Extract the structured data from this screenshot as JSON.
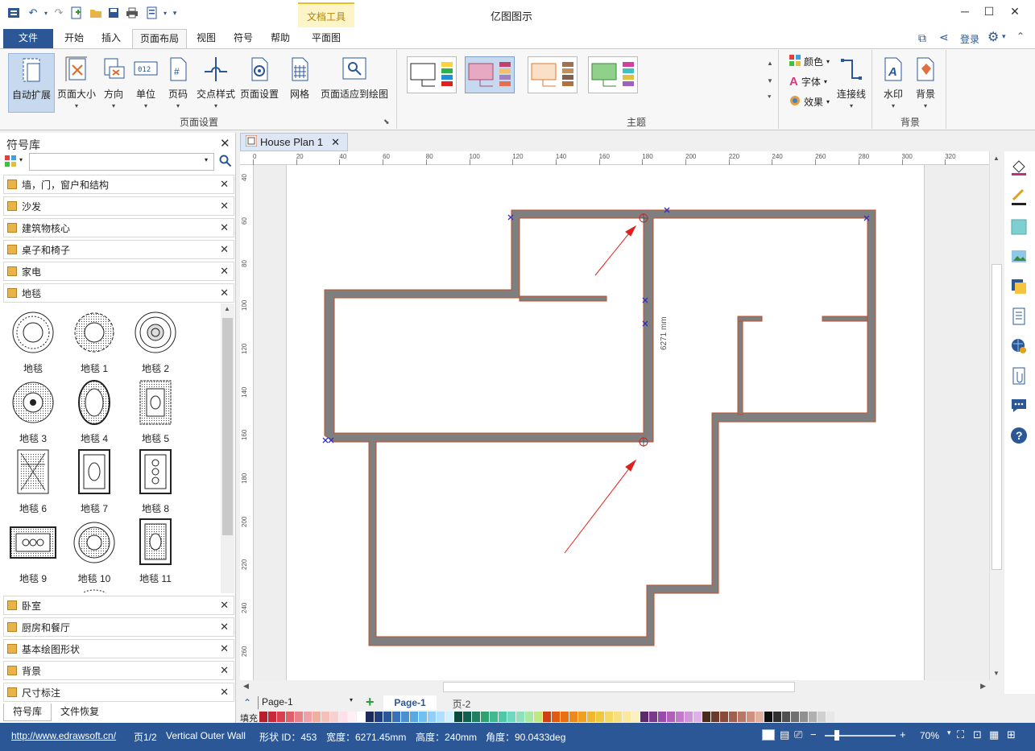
{
  "app": {
    "title": "亿图图示"
  },
  "ribbon": {
    "context_tab_title": "文档工具",
    "tabs": [
      "文件",
      "开始",
      "插入",
      "页面布局",
      "视图",
      "符号",
      "帮助",
      "平面图"
    ],
    "active_tab": "页面布局",
    "page_setup": {
      "buttons": [
        "自动扩展",
        "页面大小",
        "方向",
        "单位",
        "页码",
        "交点样式",
        "页面设置",
        "网格",
        "页面适应到绘图"
      ],
      "group_label": "页面设置"
    },
    "theme": {
      "group_label": "主题",
      "options": [
        "颜色",
        "字体",
        "效果"
      ],
      "connector_label": "连接线"
    },
    "background": {
      "buttons": [
        "水印",
        "背景"
      ],
      "group_label": "背景"
    },
    "login": "登录"
  },
  "library": {
    "title": "符号库",
    "search_placeholder": "",
    "categories_top": [
      "墙，门，窗户和结构",
      "沙发",
      "建筑物核心",
      "桌子和椅子",
      "家电",
      "地毯"
    ],
    "symbols": [
      "地毯",
      "地毯 1",
      "地毯 2",
      "地毯 3",
      "地毯 4",
      "地毯 5",
      "地毯 6",
      "地毯 7",
      "地毯 8",
      "地毯 9",
      "地毯 10",
      "地毯 11"
    ],
    "categories_bottom": [
      "卧室",
      "厨房和餐厅",
      "基本绘图形状",
      "背景",
      "尺寸标注"
    ],
    "bottom_tabs": [
      "符号库",
      "文件恢复"
    ]
  },
  "document": {
    "tab_title": "House Plan 1",
    "ruler_h": [
      "0",
      "20",
      "40",
      "60",
      "80",
      "100",
      "120",
      "140",
      "160",
      "180",
      "200",
      "220",
      "240",
      "260",
      "280",
      "300",
      "320"
    ],
    "ruler_v": [
      "40",
      "60",
      "80",
      "100",
      "120",
      "140",
      "160",
      "180",
      "200",
      "220",
      "240",
      "260"
    ],
    "dimension_label": "6271 mm"
  },
  "pages": {
    "selector": "Page-1",
    "tabs": [
      "Page-1",
      "页-2"
    ],
    "active": "Page-1"
  },
  "palette": {
    "label": "填充"
  },
  "status": {
    "url": "http://www.edrawsoft.cn/",
    "page": "页1/2",
    "shape_name": "Vertical Outer Wall",
    "shape_id": "形状 ID：453",
    "width": "宽度：6271.45mm",
    "height": "高度：240mm",
    "angle": "角度：90.0433deg",
    "zoom": "70%"
  },
  "colors": {
    "accent": "#2b5797",
    "wall_fill": "#7f7f7f",
    "wall_outline": "#c0502a",
    "arrow": "#e0201c"
  }
}
